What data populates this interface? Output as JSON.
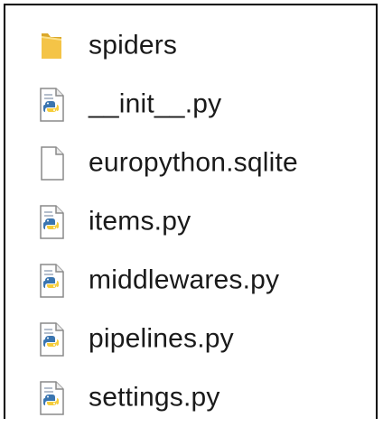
{
  "explorer": {
    "items": [
      {
        "name": "spiders",
        "icon": "folder-icon"
      },
      {
        "name": "__init__.py",
        "icon": "python-file-icon"
      },
      {
        "name": "europython.sqlite",
        "icon": "blank-file-icon"
      },
      {
        "name": "items.py",
        "icon": "python-file-icon"
      },
      {
        "name": "middlewares.py",
        "icon": "python-file-icon"
      },
      {
        "name": "pipelines.py",
        "icon": "python-file-icon"
      },
      {
        "name": "settings.py",
        "icon": "python-file-icon"
      }
    ]
  },
  "colors": {
    "folder": "#f4c447",
    "folder_dark": "#dba82a",
    "python_blue": "#3a75b0",
    "python_yellow": "#f6cd3a",
    "page_border": "#8a8a8a",
    "frame_border": "#000000"
  }
}
